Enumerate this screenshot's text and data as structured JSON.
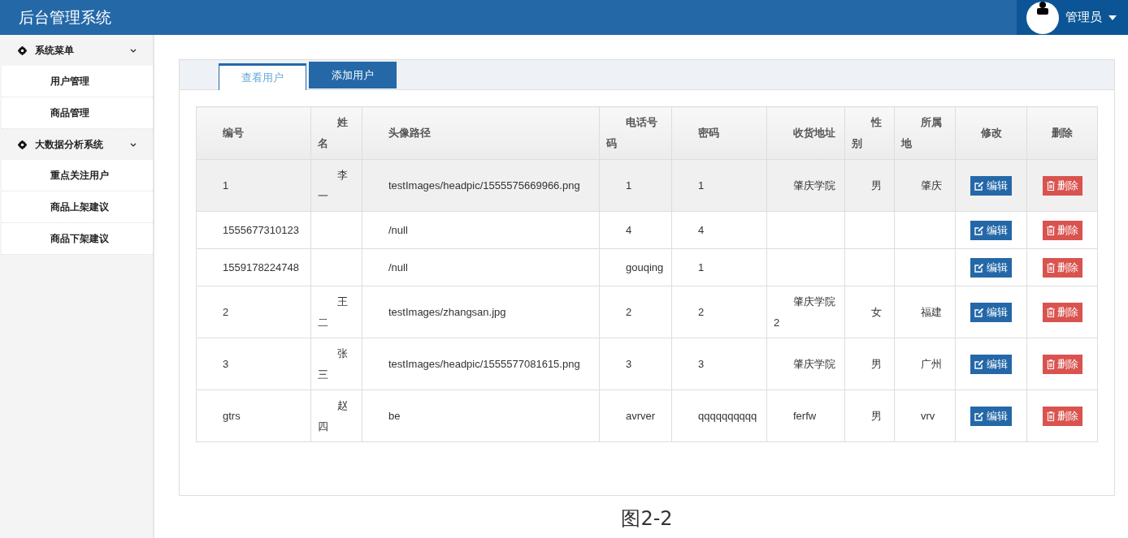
{
  "header": {
    "title": "后台管理系统",
    "user": "管理员"
  },
  "sidebar": {
    "groups": [
      {
        "label": "系统菜单",
        "expanded": true,
        "items": [
          {
            "label": "用户管理"
          },
          {
            "label": "商品管理"
          }
        ]
      },
      {
        "label": "大数据分析系统",
        "expanded": true,
        "items": [
          {
            "label": "重点关注用户"
          },
          {
            "label": "商品上架建议"
          },
          {
            "label": "商品下架建议"
          }
        ]
      }
    ]
  },
  "tabs": [
    {
      "label": "查看用户",
      "selected": true
    },
    {
      "label": "添加用户",
      "selected": false
    }
  ],
  "table": {
    "columns": [
      "编号",
      "姓名",
      "头像路径",
      "电话号码",
      "密码",
      "收货地址",
      "性别",
      "所属地",
      "修改",
      "删除"
    ],
    "rows": [
      {
        "selected": true,
        "cells": [
          "1",
          "李一",
          "testImages/headpic/1555575669966.png",
          "1",
          "1",
          "肇庆学院",
          "男",
          "肇庆"
        ],
        "edit": "编辑",
        "delete": "删除"
      },
      {
        "selected": false,
        "cells": [
          "1555677310123",
          "",
          "/null",
          "4",
          "4",
          "",
          "",
          ""
        ],
        "edit": "编辑",
        "delete": "删除"
      },
      {
        "selected": false,
        "cells": [
          "1559178224748",
          "",
          "/null",
          "gouqing",
          "1",
          "",
          "",
          ""
        ],
        "edit": "编辑",
        "delete": "删除"
      },
      {
        "selected": false,
        "cells": [
          "2",
          "王二",
          "testImages/zhangsan.jpg",
          "2",
          "2",
          "肇庆学院2",
          "女",
          "福建"
        ],
        "edit": "编辑",
        "delete": "删除"
      },
      {
        "selected": false,
        "cells": [
          "3",
          "张三",
          "testImages/headpic/1555577081615.png",
          "3",
          "3",
          "肇庆学院",
          "男",
          "广州"
        ],
        "edit": "编辑",
        "delete": "删除"
      },
      {
        "selected": false,
        "cells": [
          "gtrs",
          "赵四",
          "be",
          "avrver",
          "qqqqqqqqqq",
          "ferfw",
          "男",
          "vrv"
        ],
        "edit": "编辑",
        "delete": "删除"
      }
    ]
  },
  "caption": "图2-2"
}
